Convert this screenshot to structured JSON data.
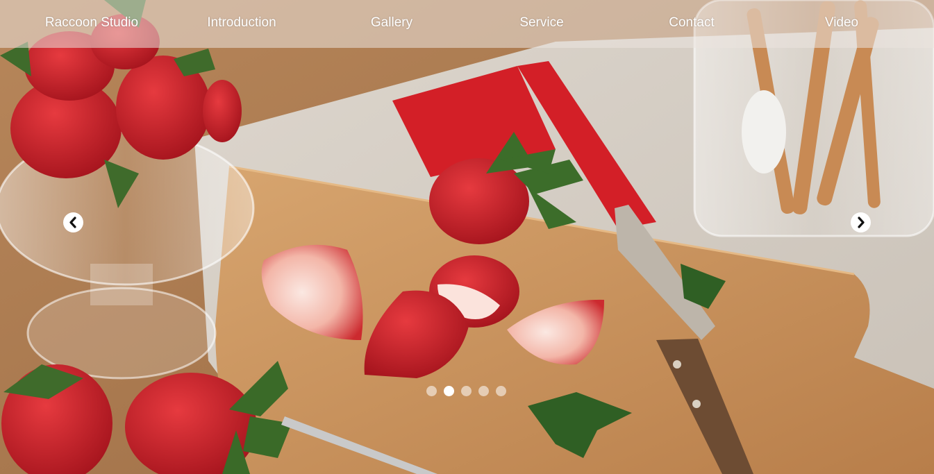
{
  "nav": {
    "brand": "Raccoon Studio",
    "items": [
      {
        "label": "Introduction"
      },
      {
        "label": "Gallery"
      },
      {
        "label": "Service"
      },
      {
        "label": "Contact"
      },
      {
        "label": "Video"
      }
    ]
  },
  "carousel": {
    "slide_count": 5,
    "active_index": 2,
    "prev_icon": "chevron-left-icon",
    "next_icon": "chevron-right-icon"
  },
  "colors": {
    "nav_overlay": "#ebe4de",
    "nav_text": "#ffffff",
    "dot_active": "#ffffff",
    "strawberry": "#c8202a",
    "board": "#c8915c",
    "table": "#a9774b",
    "cloth": "#d9d2c9",
    "stripe": "#d31f27"
  }
}
